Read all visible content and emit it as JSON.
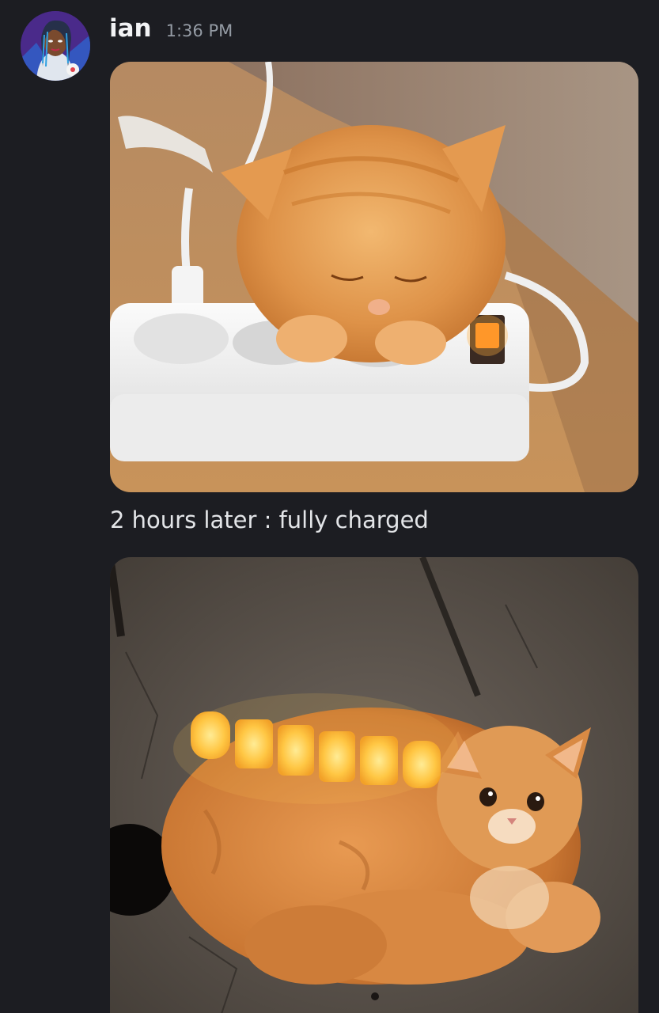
{
  "message": {
    "author": "ian",
    "timestamp": "1:36 PM",
    "text": "2 hours later : fully charged",
    "avatar_icon": "avatar-character-portrait",
    "attachments": [
      {
        "name": "kitten-sleeping-on-power-strip",
        "kind": "image"
      },
      {
        "name": "cat-with-battery-lights",
        "kind": "image"
      }
    ]
  },
  "colors": {
    "background": "#1c1d22",
    "username": "#f2f3f5",
    "timestamp": "#949ba4",
    "text": "#e3e5e8"
  }
}
